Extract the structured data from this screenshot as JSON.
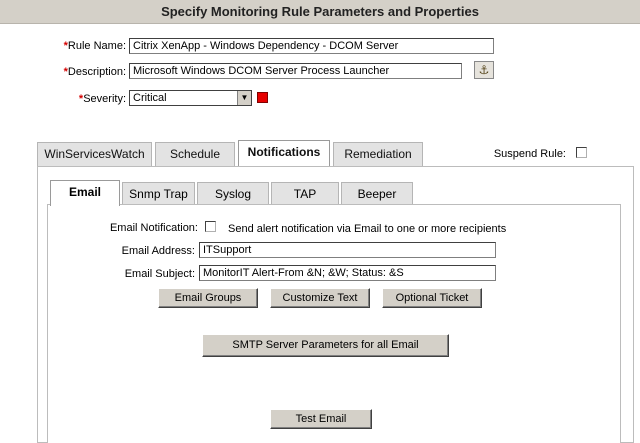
{
  "page": {
    "title": "Specify Monitoring Rule Parameters and Properties"
  },
  "rule": {
    "name_label": "Rule Name:",
    "name_value": "Citrix XenApp - Windows Dependency - DCOM Server",
    "description_label": "Description:",
    "description_value": "Microsoft Windows DCOM Server Process Launcher",
    "severity_label": "Severity:",
    "severity_value": "Critical",
    "severity_color": "#e60000",
    "required_marker": "*",
    "lookup_icon": "pin-lookup-icon"
  },
  "tabs": {
    "items": [
      "WinServicesWatch",
      "Schedule",
      "Notifications",
      "Remediation"
    ],
    "active": "Notifications",
    "suspend_label": "Suspend Rule:"
  },
  "subtabs": {
    "items": [
      "Email",
      "Snmp Trap",
      "Syslog",
      "TAP",
      "Beeper"
    ],
    "active": "Email"
  },
  "email": {
    "notification_label": "Email Notification:",
    "notification_text": "Send alert notification via Email to one or more recipients",
    "address_label": "Email Address:",
    "address_value": "ITSupport",
    "subject_label": "Email Subject:",
    "subject_value": "MonitorIT Alert-From &N; &W; Status: &S",
    "btn_groups": "Email Groups",
    "btn_customize": "Customize Text",
    "btn_ticket": "Optional Ticket",
    "btn_smtp": "SMTP Server Parameters for all Email",
    "btn_test": "Test Email"
  }
}
